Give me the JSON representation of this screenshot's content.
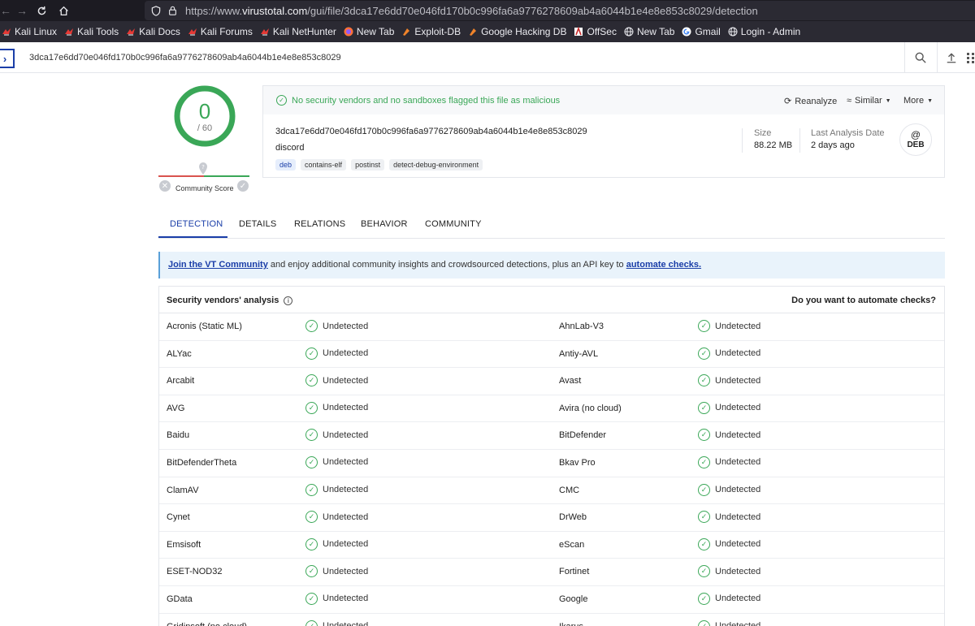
{
  "browser": {
    "url_prefix": "https://www.",
    "url_host": "virustotal.com",
    "url_path": "/gui/file/3dca17e6dd70e046fd170b0c996fa6a9776278609ab4a6044b1e4e8e853c8029/detection"
  },
  "bookmarks": [
    {
      "label": "Kali Linux",
      "icon": "kali-dragon-icon"
    },
    {
      "label": "Kali Tools",
      "icon": "kali-dragon-icon"
    },
    {
      "label": "Kali Docs",
      "icon": "kali-dragon-icon"
    },
    {
      "label": "Kali Forums",
      "icon": "kali-dragon-icon"
    },
    {
      "label": "Kali NetHunter",
      "icon": "kali-dragon-icon"
    },
    {
      "label": "New Tab",
      "icon": "firefox-icon"
    },
    {
      "label": "Exploit-DB",
      "icon": "exploit-db-icon"
    },
    {
      "label": "Google Hacking DB",
      "icon": "exploit-db-icon"
    },
    {
      "label": "OffSec",
      "icon": "offsec-icon"
    },
    {
      "label": "New Tab",
      "icon": "globe-icon"
    },
    {
      "label": "Gmail",
      "icon": "google-icon"
    },
    {
      "label": "Login - Admin",
      "icon": "globe-icon"
    }
  ],
  "header": {
    "search_value": "3dca17e6dd70e046fd170b0c996fa6a9776278609ab4a6044b1e4e8e853c8029"
  },
  "score": {
    "detections": "0",
    "total": "/ 60",
    "community_label": "Community Score"
  },
  "summary": {
    "message": "No security vendors and no sandboxes flagged this file as malicious",
    "reanalyze": "Reanalyze",
    "similar": "Similar",
    "more": "More",
    "hash": "3dca17e6dd70e046fd170b0c996fa6a9776278609ab4a6044b1e4e8e853c8029",
    "name": "discord",
    "tags": [
      "deb",
      "contains-elf",
      "postinst",
      "detect-debug-environment"
    ],
    "size_label": "Size",
    "size_value": "88.22 MB",
    "last_label": "Last Analysis Date",
    "last_value": "2 days ago",
    "file_type": "DEB"
  },
  "tabs": [
    "DETECTION",
    "DETAILS",
    "RELATIONS",
    "BEHAVIOR",
    "COMMUNITY"
  ],
  "banner": {
    "link1": "Join the VT Community",
    "middle": " and enjoy additional community insights and crowdsourced detections, plus an API key to ",
    "link2": "automate checks."
  },
  "vendors": {
    "title": "Security vendors' analysis",
    "automate": "Do you want to automate checks?",
    "result": "Undetected",
    "rows": [
      [
        "Acronis (Static ML)",
        "AhnLab-V3"
      ],
      [
        "ALYac",
        "Antiy-AVL"
      ],
      [
        "Arcabit",
        "Avast"
      ],
      [
        "AVG",
        "Avira (no cloud)"
      ],
      [
        "Baidu",
        "BitDefender"
      ],
      [
        "BitDefenderTheta",
        "Bkav Pro"
      ],
      [
        "ClamAV",
        "CMC"
      ],
      [
        "Cynet",
        "DrWeb"
      ],
      [
        "Emsisoft",
        "eScan"
      ],
      [
        "ESET-NOD32",
        "Fortinet"
      ],
      [
        "GData",
        "Google"
      ],
      [
        "Gridinsoft (no cloud)",
        "Ikarus"
      ]
    ]
  },
  "colors": {
    "accent": "#1a3ea8",
    "clean": "#3aa757"
  }
}
